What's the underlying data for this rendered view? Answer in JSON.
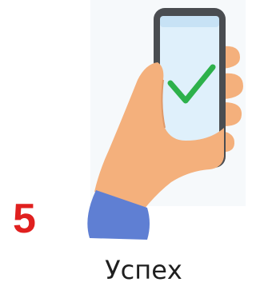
{
  "step": {
    "number": "5",
    "caption": "Успех"
  },
  "icons": {
    "illustration": "hand-holding-phone-with-checkmark",
    "status": "checkmark-icon"
  },
  "colors": {
    "step_number": "#e0201f",
    "checkmark": "#2db14b",
    "screen": "#dff0fb",
    "phone_frame": "#4a4d51",
    "skin": "#f4b07c",
    "sleeve": "#5f7fd3"
  }
}
